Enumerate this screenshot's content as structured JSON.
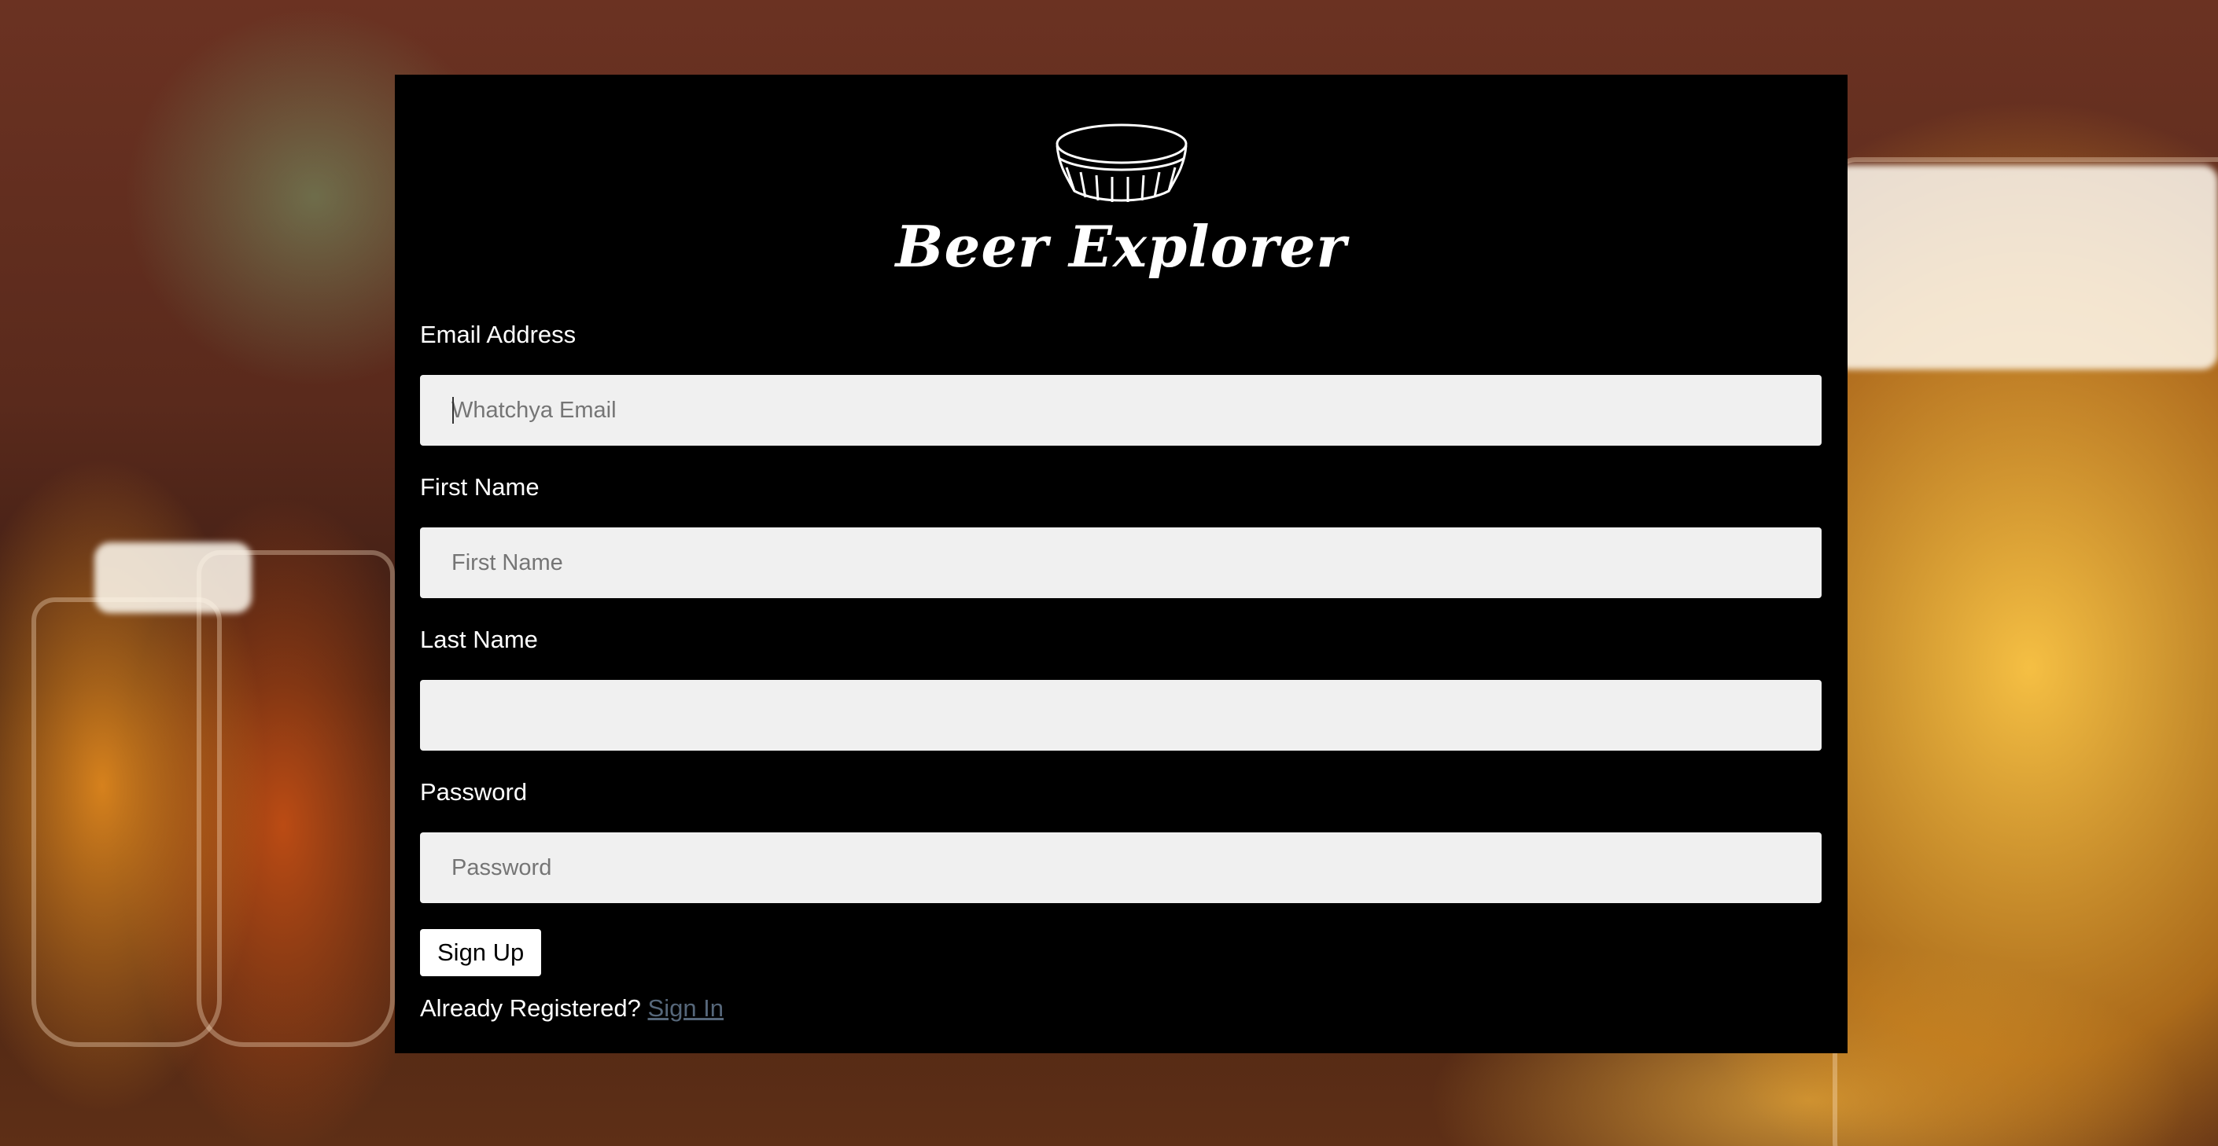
{
  "app": {
    "brand_name": "Beer Explorer",
    "logo_icon": "bottle-cap-icon"
  },
  "form": {
    "email": {
      "label": "Email Address",
      "placeholder": "Whatchya Email",
      "value": ""
    },
    "first_name": {
      "label": "First Name",
      "placeholder": "First Name",
      "value": ""
    },
    "last_name": {
      "label": "Last Name",
      "placeholder": "",
      "value": ""
    },
    "password": {
      "label": "Password",
      "placeholder": "Password",
      "value": ""
    },
    "submit_label": "Sign Up"
  },
  "footer": {
    "prompt": "Already Registered?",
    "link_label": "Sign In"
  },
  "colors": {
    "card_background": "#000000",
    "input_background": "#f0f0f0",
    "link": "#56677a"
  }
}
